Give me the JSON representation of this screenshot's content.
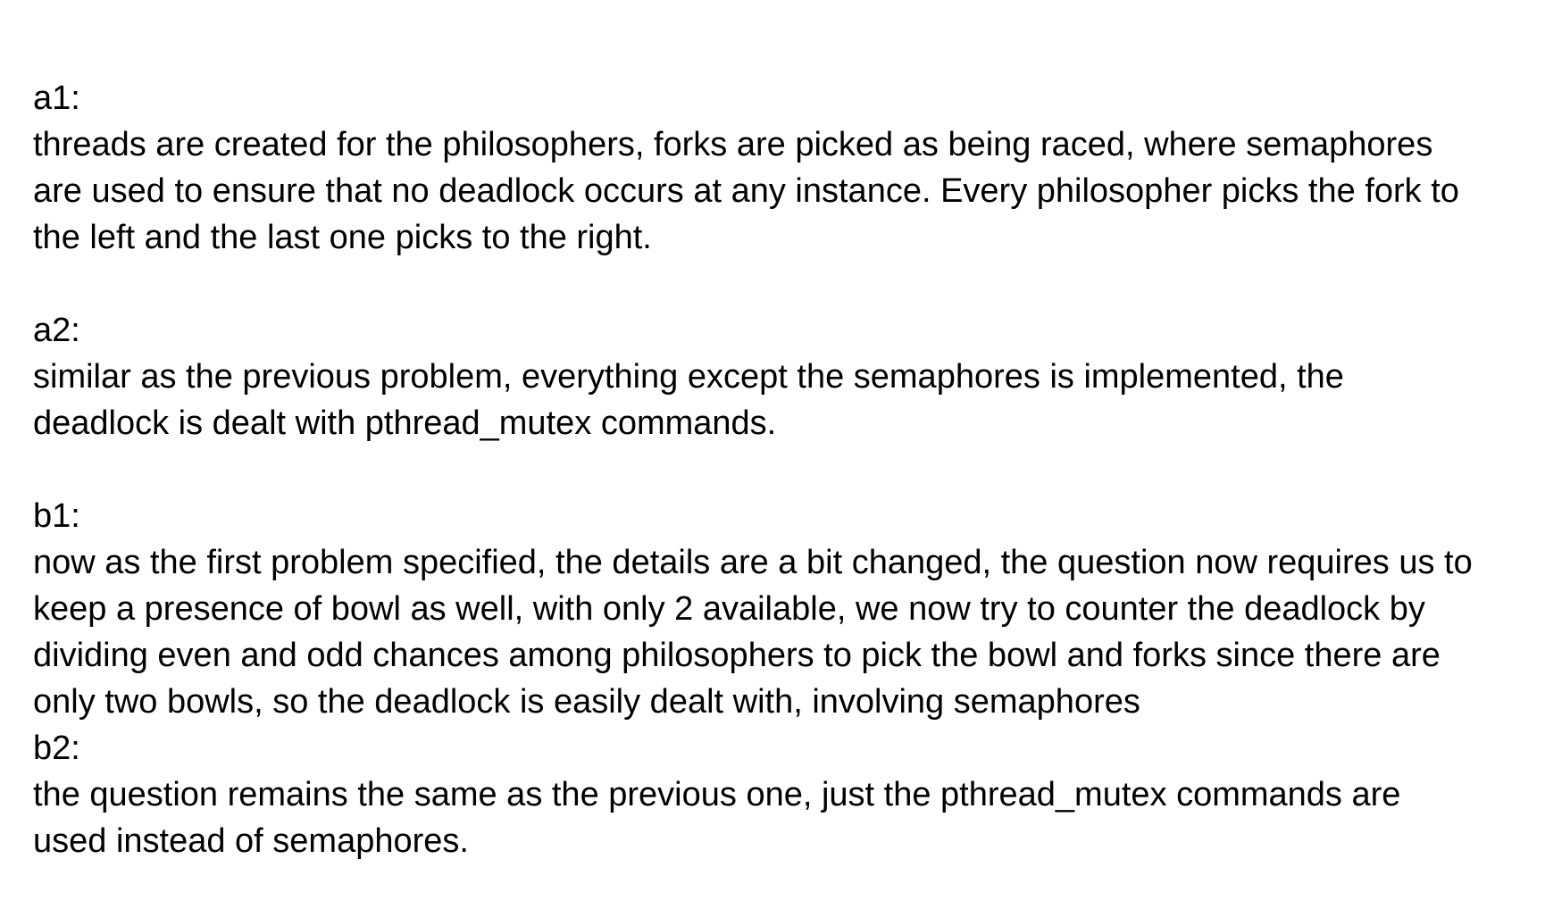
{
  "sections": [
    {
      "label": "a1:",
      "lines": [
        "threads are created for the philosophers, forks are picked as being raced, where semaphores",
        "are used to ensure that no deadlock occurs at any instance. Every philosopher picks the fork to",
        "the left and the last one picks to the right."
      ]
    },
    {
      "label": "a2:",
      "lines": [
        "similar as the previous problem, everything except the semaphores is implemented, the",
        "deadlock is dealt with pthread_mutex commands."
      ]
    },
    {
      "label": "b1:",
      "lines": [
        "now as the first problem specified, the details are a bit changed, the question now requires us to",
        "keep a presence of bowl as well, with only 2 available, we now try to counter the deadlock by",
        "dividing even and odd chances among philosophers to pick the bowl and forks since there are",
        "only two bowls, so the deadlock is easily dealt with, involving semaphores"
      ]
    },
    {
      "label": "b2:",
      "lines": [
        "the question remains the same as the previous one, just the pthread_mutex commands are",
        "used instead of semaphores."
      ]
    }
  ]
}
